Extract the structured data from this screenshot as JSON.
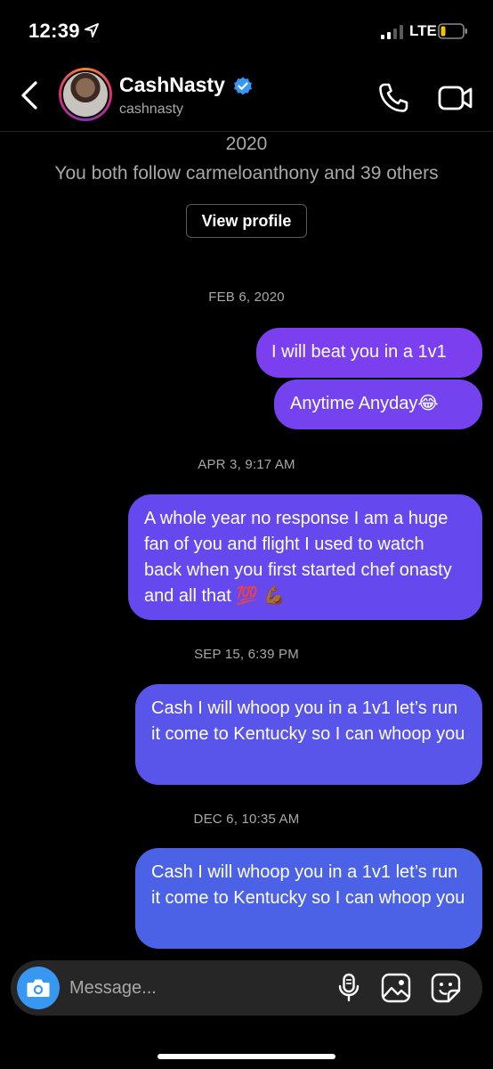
{
  "status_bar": {
    "time": "12:39",
    "network": "LTE",
    "icons": [
      "location-arrow-icon",
      "signal-icon",
      "battery-icon"
    ]
  },
  "header": {
    "name": "CashNasty",
    "handle": "cashnasty",
    "icons": [
      "back-chevron-icon",
      "verified-badge-icon",
      "phone-icon",
      "video-camera-icon"
    ]
  },
  "intro": {
    "year": "2020",
    "mutual_followers": "You both follow carmeloanthony and 39 others",
    "view_profile_label": "View profile"
  },
  "messages": [
    {
      "timestamp": "FEB 6, 2020"
    },
    {
      "text": "I will beat you in a 1v1"
    },
    {
      "text": "Anytime Anyday😂"
    },
    {
      "timestamp": "APR 3, 9:17 AM"
    },
    {
      "text": "A whole year no response I am a huge fan of you and flight I used to watch back when you first started chef onasty and all that 💯 💪🏾"
    },
    {
      "timestamp": "SEP 15, 6:39 PM"
    },
    {
      "text": "Cash I will whoop you in a 1v1 let’s run it come to Kentucky so I can whoop you"
    },
    {
      "timestamp": "DEC 6, 10:35 AM"
    },
    {
      "text": "Cash I will whoop you in a 1v1 let’s run it come to Kentucky so I can whoop you"
    }
  ],
  "composer": {
    "placeholder": "Message...",
    "icons": [
      "camera-icon",
      "microphone-icon",
      "gallery-icon",
      "sticker-icon"
    ]
  },
  "colors": {
    "background": "#000000",
    "bubble_gradient": [
      "#7b3ff0",
      "#4b62e6"
    ],
    "camera_button": "#3897f0",
    "verified": "#3897f0"
  }
}
